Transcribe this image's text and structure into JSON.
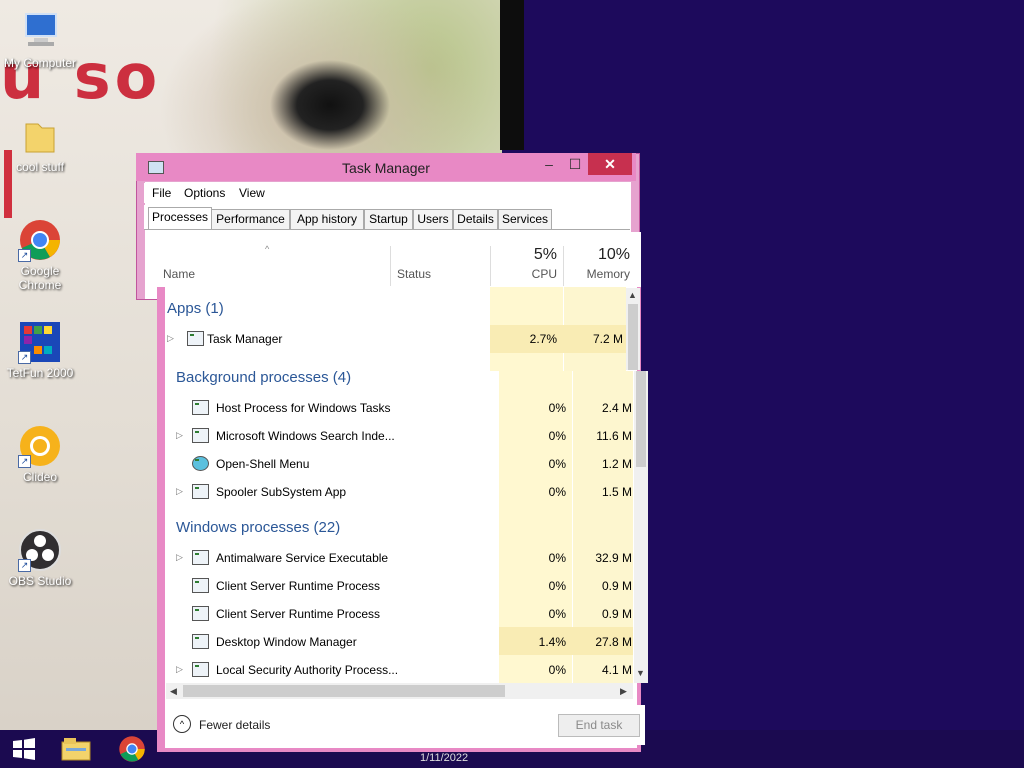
{
  "desktop": {
    "wallpaper_text": "u so",
    "icons": [
      {
        "label": "My Computer"
      },
      {
        "label": "cool stuff"
      },
      {
        "label": "Google Chrome"
      },
      {
        "label": "TetFun 2000"
      },
      {
        "label": "Clideo"
      },
      {
        "label": "OBS Studio"
      }
    ]
  },
  "taskbar": {
    "clock": "1/11/2022"
  },
  "window": {
    "title": "Task Manager",
    "controls": {
      "minimize": "–",
      "maximize": "☐",
      "close": "✕"
    },
    "menu": [
      "File",
      "Options",
      "View"
    ],
    "tabs": [
      "Processes",
      "Performance",
      "App history",
      "Startup",
      "Users",
      "Details",
      "Services"
    ],
    "active_tab": "Processes"
  },
  "table": {
    "columns": {
      "name": "Name",
      "status": "Status",
      "cpu": "CPU",
      "memory": "Memory"
    },
    "cpu_total": "5%",
    "memory_total": "10%",
    "groups": [
      {
        "label": "Apps (1)",
        "rows": [
          {
            "name": "Task Manager",
            "cpu": "2.7%",
            "memory": "7.2 M",
            "expandable": true
          }
        ]
      },
      {
        "label": "Background processes (4)",
        "rows": [
          {
            "name": "Host Process for Windows Tasks",
            "cpu": "0%",
            "memory": "2.4 M",
            "expandable": false
          },
          {
            "name": "Microsoft Windows Search Inde...",
            "cpu": "0%",
            "memory": "11.6 M",
            "expandable": true
          },
          {
            "name": "Open-Shell Menu",
            "cpu": "0%",
            "memory": "1.2 M",
            "expandable": false
          },
          {
            "name": "Spooler SubSystem App",
            "cpu": "0%",
            "memory": "1.5 M",
            "expandable": true
          }
        ]
      },
      {
        "label": "Windows processes (22)",
        "rows": [
          {
            "name": "Antimalware Service Executable",
            "cpu": "0%",
            "memory": "32.9 M",
            "expandable": true
          },
          {
            "name": "Client Server Runtime Process",
            "cpu": "0%",
            "memory": "0.9 M",
            "expandable": false
          },
          {
            "name": "Client Server Runtime Process",
            "cpu": "0%",
            "memory": "0.9 M",
            "expandable": false
          },
          {
            "name": "Desktop Window Manager",
            "cpu": "1.4%",
            "memory": "27.8 M",
            "expandable": false
          },
          {
            "name": "Local Security Authority Process...",
            "cpu": "0%",
            "memory": "4.1 M",
            "expandable": true
          }
        ]
      }
    ]
  },
  "footer": {
    "fewer_details": "Fewer details",
    "end_task": "End task"
  }
}
